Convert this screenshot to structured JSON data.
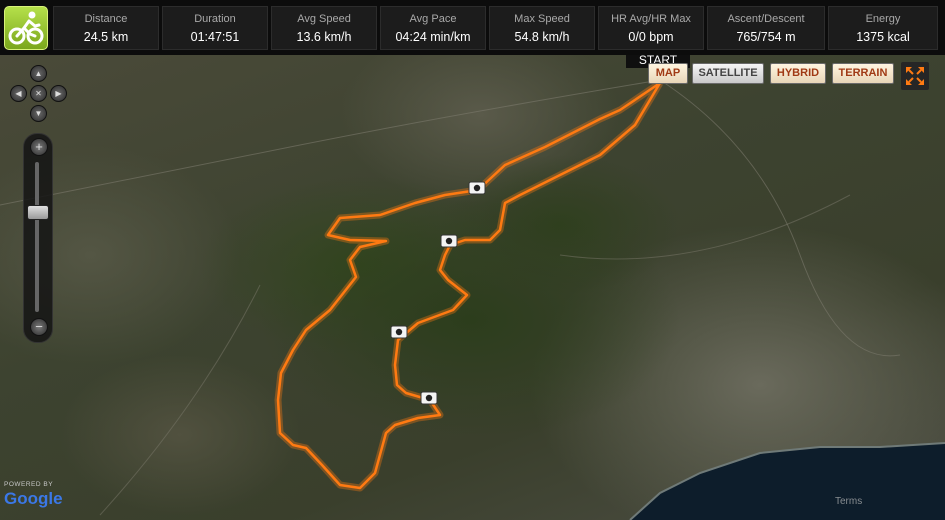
{
  "stats": [
    {
      "label": "Distance",
      "value": "24.5 km"
    },
    {
      "label": "Duration",
      "value": "01:47:51"
    },
    {
      "label": "Avg Speed",
      "value": "13.6 km/h"
    },
    {
      "label": "Avg Pace",
      "value": "04:24 min/km"
    },
    {
      "label": "Max Speed",
      "value": "54.8 km/h"
    },
    {
      "label": "HR Avg/HR Max",
      "value": "0/0 bpm"
    },
    {
      "label": "Ascent/Descent",
      "value": "765/754 m"
    },
    {
      "label": "Energy",
      "value": "1375 kcal"
    }
  ],
  "map": {
    "start_label": "START",
    "map_types": [
      {
        "label": "MAP",
        "active": true
      },
      {
        "label": "SATELLITE",
        "active": false
      },
      {
        "label": "HYBRID",
        "active": true
      },
      {
        "label": "TERRAIN",
        "active": true
      }
    ],
    "powered_by": "POWERED BY",
    "google_logo": "Google",
    "terms": "Terms"
  },
  "colors": {
    "route": "#ff7a12",
    "accent": "#9ccb2f",
    "active_map_type": "#a03a15"
  },
  "icons": {
    "activity": "cyclist-icon",
    "photo_marker": "camera-icon",
    "fullscreen": "expand-icon"
  }
}
